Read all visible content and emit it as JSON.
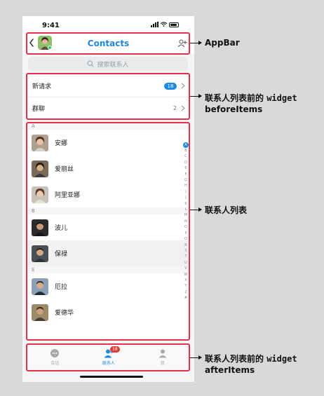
{
  "status_bar": {
    "time": "9:41"
  },
  "appbar": {
    "title": "Contacts"
  },
  "search": {
    "placeholder": "搜索联系人"
  },
  "before_items": [
    {
      "label": "新请求",
      "badge": "18"
    },
    {
      "label": "群聊",
      "count": "2"
    }
  ],
  "contacts": {
    "sections": [
      {
        "letter": "A",
        "items": [
          "安娜",
          "爱丽丝",
          "阿里亚娜"
        ]
      },
      {
        "letter": "B",
        "items": [
          "波儿",
          "保禄"
        ]
      },
      {
        "letter": "E",
        "items": [
          "厄拉",
          "爱德华"
        ]
      }
    ],
    "index": [
      "A",
      "B",
      "C",
      "D",
      "E",
      "F",
      "G",
      "H",
      "I",
      "J",
      "K",
      "L",
      "M",
      "N",
      "O",
      "P",
      "Q",
      "R",
      "S",
      "T",
      "U",
      "V",
      "W",
      "X",
      "Y",
      "Z",
      "#"
    ]
  },
  "tabbar": {
    "tabs": [
      {
        "label": "会话",
        "icon": "chat-icon"
      },
      {
        "label": "联系人",
        "icon": "contacts-icon",
        "badge": "18"
      },
      {
        "label": "我",
        "icon": "person-icon"
      }
    ]
  },
  "annotations": {
    "appbar": "AppBar",
    "before_prefix": "联系人列表前的",
    "before_code": "widget",
    "before_name": "beforeItems",
    "list": "联系人列表",
    "after_prefix": "联系人列表前的",
    "after_code": "widget",
    "after_name": "afterItems"
  },
  "colors": {
    "accent": "#1e88e5",
    "callout": "#e8304d",
    "badge": "#e53935"
  }
}
